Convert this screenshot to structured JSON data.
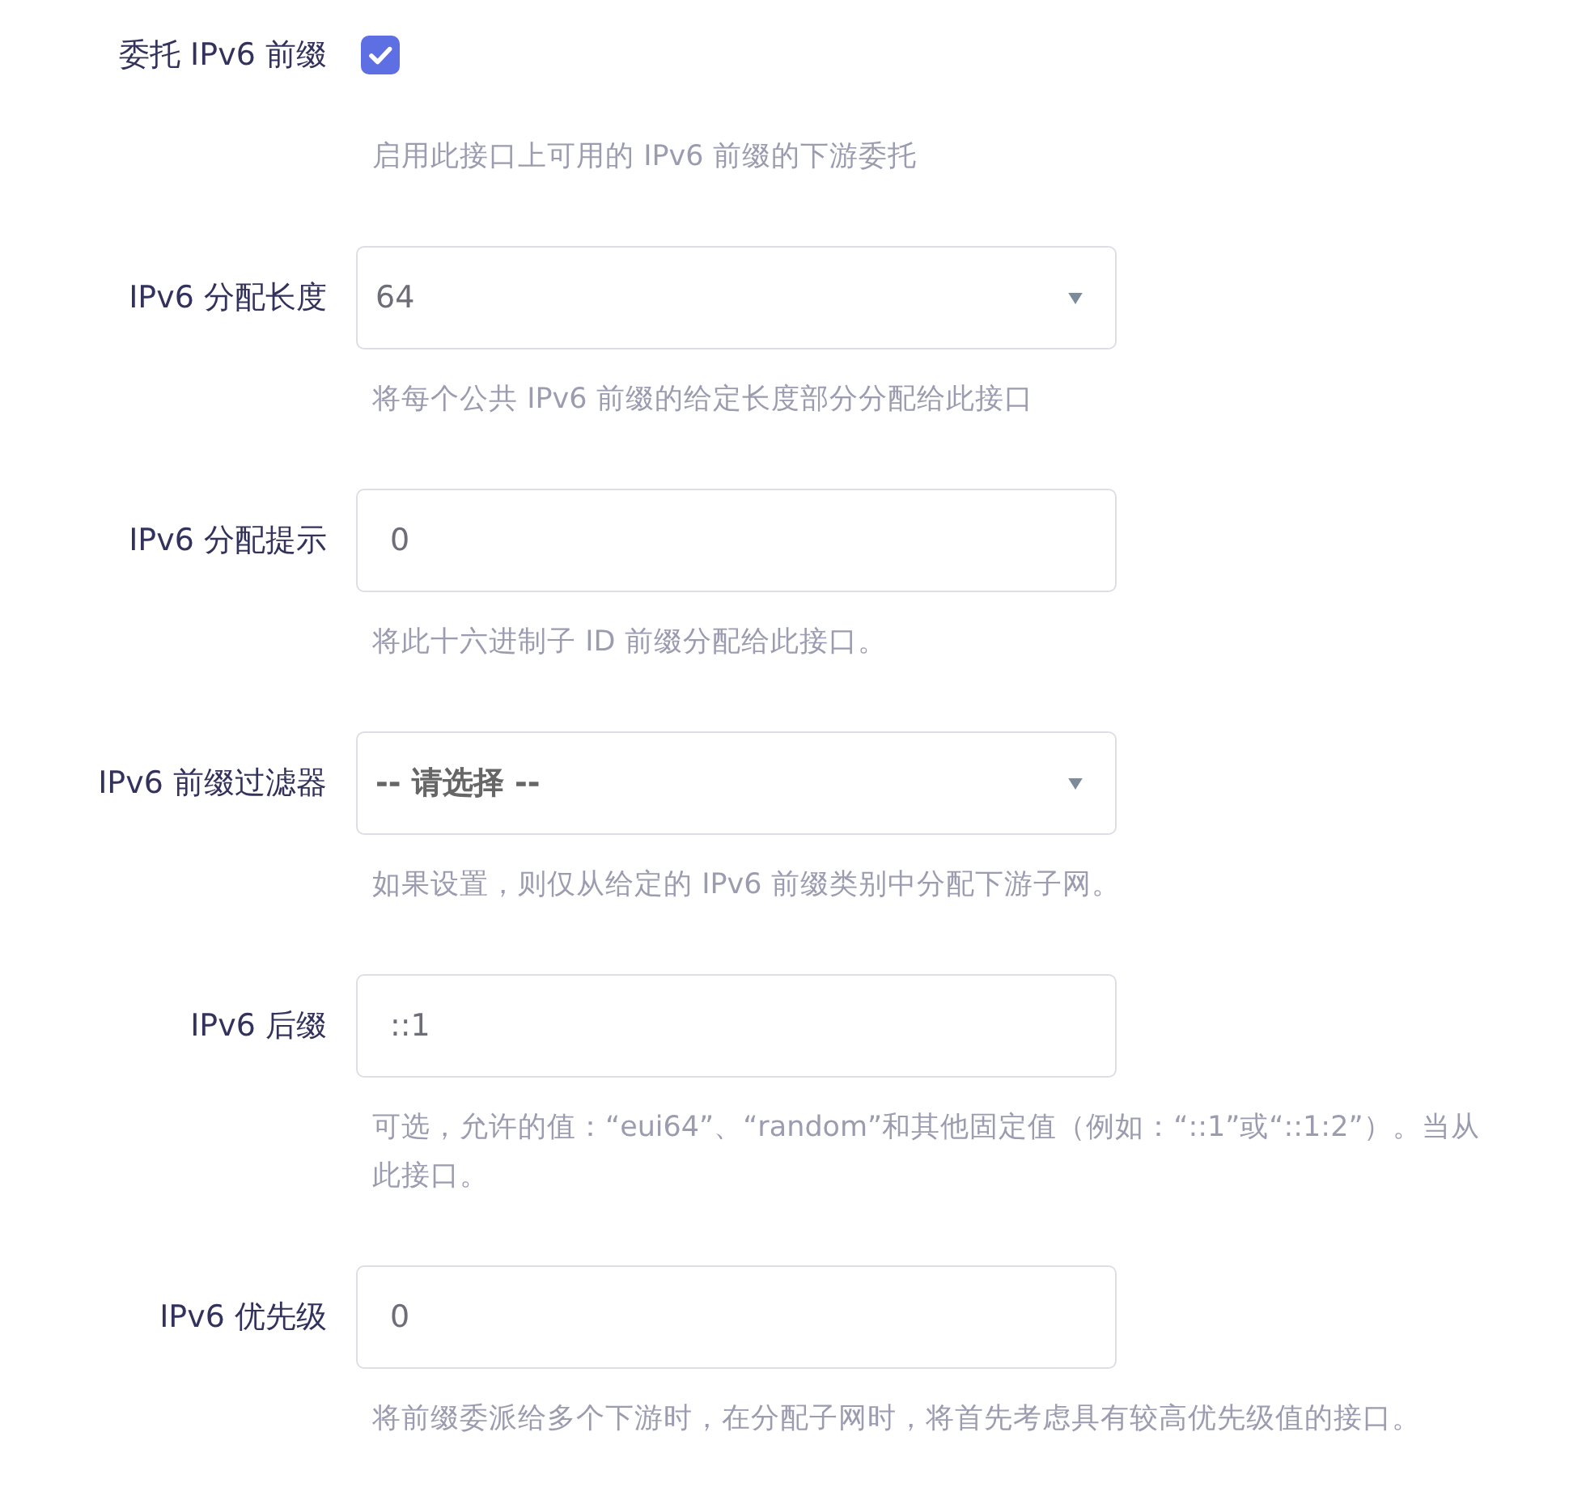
{
  "fields": [
    {
      "kind": "checkbox",
      "label": "委托 IPv6 前缀",
      "checked": true,
      "description": [
        "启用此接口上可用的 IPv6 前缀的下游委托"
      ]
    },
    {
      "kind": "select",
      "label": "IPv6 分配长度",
      "value": "64",
      "unset": false,
      "description": [
        "将每个公共 IPv6 前缀的给定长度部分分配给此接口"
      ]
    },
    {
      "kind": "input",
      "label": "IPv6 分配提示",
      "value": "0",
      "description": [
        "将此十六进制子 ID 前缀分配给此接口。"
      ]
    },
    {
      "kind": "select",
      "label": "IPv6 前缀过滤器",
      "value": "-- 请选择 --",
      "unset": true,
      "description": [
        "如果设置，则仅从给定的 IPv6 前缀类别中分配下游子网。"
      ]
    },
    {
      "kind": "input",
      "label": "IPv6 后缀",
      "value": "::1",
      "description": [
        "可选，允许的值：“eui64”、“random”和其他固定值（例如：“::1”或“::1:2”）。当从",
        "此接口。"
      ]
    },
    {
      "kind": "input",
      "label": "IPv6 优先级",
      "value": "0",
      "description": [
        "将前缀委派给多个下游时，在分配子网时，将首先考虑具有较高优先级值的接口。"
      ]
    }
  ]
}
